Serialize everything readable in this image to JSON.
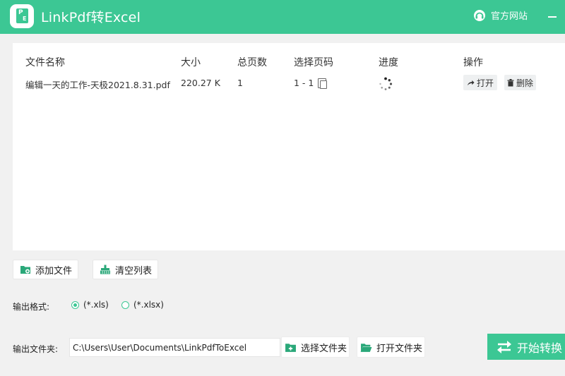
{
  "app": {
    "title": "LinkPdf转Excel",
    "site_link": "官方网站"
  },
  "table": {
    "headers": [
      "文件名称",
      "大小",
      "总页数",
      "选择页码",
      "进度",
      "操作"
    ],
    "rows": [
      {
        "name": "编辑一天的工作-天极2021.8.31.pdf",
        "size": "220.27 K",
        "pages": "1",
        "range": "1 - 1",
        "open_label": "打开",
        "delete_label": "删除"
      }
    ]
  },
  "actions": {
    "add_file": "添加文件",
    "clear_list": "清空列表"
  },
  "format": {
    "label": "输出格式:",
    "options": [
      "(*.xls)",
      "(*.xlsx)"
    ],
    "selected": "(*.xls)"
  },
  "output": {
    "label": "输出文件夹:",
    "path": "C:\\Users\\User\\Documents\\LinkPdfToExcel",
    "choose_folder": "选择文件夹",
    "open_folder": "打开文件夹"
  },
  "start_button": "开始转换",
  "colors": {
    "accent": "#3cc794"
  }
}
